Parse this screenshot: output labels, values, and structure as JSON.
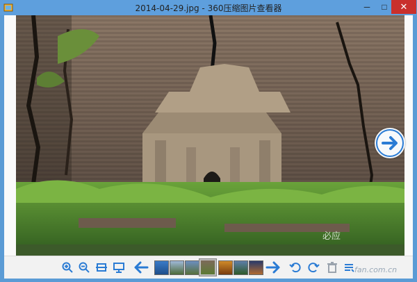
{
  "window": {
    "title": "2014-04-29.jpg - 360压缩图片查看器",
    "min_glyph": "─",
    "max_glyph": "□",
    "close_glyph": "✕"
  },
  "viewer": {
    "next_icon": "right-arrow-circle-icon",
    "watermark": "必应"
  },
  "toolbar": {
    "icons": [
      "zoom-in-icon",
      "zoom-out-icon",
      "fit-window-icon",
      "slideshow-icon",
      "previous-arrow-icon",
      "next-arrow-icon",
      "rotate-left-icon",
      "rotate-right-icon",
      "delete-icon",
      "list-icon"
    ]
  },
  "footer": {
    "site_watermark": "fan.com.cn"
  },
  "colors": {
    "titlebar": "#5e9fdd",
    "close": "#c9302c",
    "accent": "#2a7bd4"
  }
}
